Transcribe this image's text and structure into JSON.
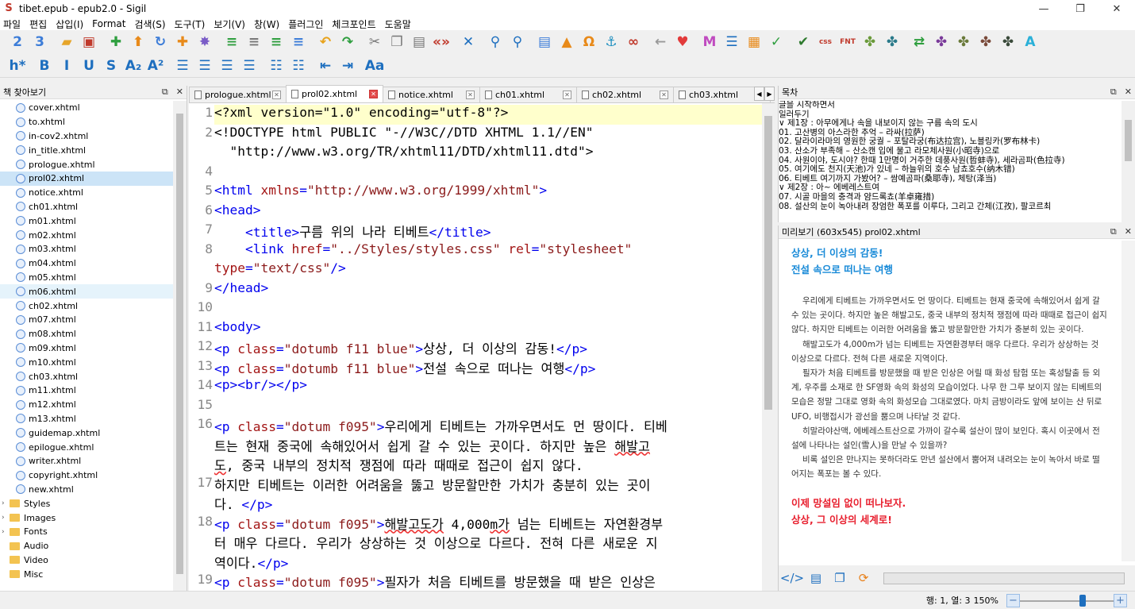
{
  "window": {
    "title": "tibet.epub - epub2.0 - Sigil",
    "app_icon": "S"
  },
  "window_controls": {
    "minimize": "—",
    "maximize": "❐",
    "close": "✕"
  },
  "menu": [
    "파일",
    "편집",
    "삽입(I)",
    "Format",
    "검색(S)",
    "도구(T)",
    "보기(V)",
    "창(W)",
    "플러그인",
    "체크포인트",
    "도움말"
  ],
  "toolbar1": [
    {
      "name": "book-view-2-icon",
      "glyph": "2",
      "color": "#3d7dd8"
    },
    {
      "name": "book-view-3-icon",
      "glyph": "3",
      "color": "#3d7dd8"
    },
    {
      "name": "sep"
    },
    {
      "name": "open-folder-icon",
      "glyph": "▰",
      "color": "#e6a52a"
    },
    {
      "name": "save-icon",
      "glyph": "▣",
      "color": "#c0392b"
    },
    {
      "name": "sep"
    },
    {
      "name": "add-file-icon",
      "glyph": "✚",
      "color": "#2e9e3e"
    },
    {
      "name": "move-up-icon",
      "glyph": "⬆",
      "color": "#e88a1a"
    },
    {
      "name": "refresh-icon",
      "glyph": "↻",
      "color": "#3d7dd8"
    },
    {
      "name": "add-plus-icon",
      "glyph": "✚",
      "color": "#e88a1a"
    },
    {
      "name": "settings-gear-icon",
      "glyph": "✸",
      "color": "#7a5cc7"
    },
    {
      "name": "sep"
    },
    {
      "name": "indent-list-icon",
      "glyph": "≡",
      "color": "#2e9e3e"
    },
    {
      "name": "outdent-list-icon",
      "glyph": "≡",
      "color": "#777"
    },
    {
      "name": "list-add-icon",
      "glyph": "≡",
      "color": "#2e9e3e"
    },
    {
      "name": "list-more-icon",
      "glyph": "≡",
      "color": "#3d7dd8"
    },
    {
      "name": "sep"
    },
    {
      "name": "undo-icon",
      "glyph": "↶",
      "color": "#e8a21a"
    },
    {
      "name": "redo-icon",
      "glyph": "↷",
      "color": "#2e9e3e"
    },
    {
      "name": "sep"
    },
    {
      "name": "cut-icon",
      "glyph": "✂",
      "color": "#777"
    },
    {
      "name": "copy-icon",
      "glyph": "❐",
      "color": "#777"
    },
    {
      "name": "paste-icon",
      "glyph": "▤",
      "color": "#777"
    },
    {
      "name": "code-tag-icon",
      "glyph": "«»",
      "color": "#c0392b"
    },
    {
      "name": "sep"
    },
    {
      "name": "validate-x-icon",
      "glyph": "✕",
      "color": "#1e6fbf"
    },
    {
      "name": "sep"
    },
    {
      "name": "search-icon",
      "glyph": "⚲",
      "color": "#1e6fbf"
    },
    {
      "name": "search-replace-icon",
      "glyph": "⚲",
      "color": "#1e6fbf"
    },
    {
      "name": "sep"
    },
    {
      "name": "insert-file-icon",
      "glyph": "▤",
      "color": "#3d7dd8"
    },
    {
      "name": "insert-image-icon",
      "glyph": "▲",
      "color": "#e88a1a"
    },
    {
      "name": "special-char-omega-icon",
      "glyph": "Ω",
      "color": "#e88a1a"
    },
    {
      "name": "anchor-icon",
      "glyph": "⚓",
      "color": "#1e8fbf"
    },
    {
      "name": "link-icon",
      "glyph": "∞",
      "color": "#c0392b"
    },
    {
      "name": "sep"
    },
    {
      "name": "back-arrow-icon",
      "glyph": "←",
      "color": "#999"
    },
    {
      "name": "heart-icon",
      "glyph": "♥",
      "color": "#e23a3a"
    },
    {
      "name": "sep"
    },
    {
      "name": "metadata-m-icon",
      "glyph": "M",
      "color": "#c04bc0"
    },
    {
      "name": "toc-list-icon",
      "glyph": "☰",
      "color": "#1e6fbf"
    },
    {
      "name": "report-icon",
      "glyph": "▦",
      "color": "#e88a1a"
    },
    {
      "name": "spellcheck-icon",
      "glyph": "✓",
      "color": "#2e9e3e"
    },
    {
      "name": "sep"
    },
    {
      "name": "check-valid-icon",
      "glyph": "✔",
      "color": "#2e7a2e"
    },
    {
      "name": "self-css-icon",
      "glyph": "css",
      "color": "#c0392b"
    },
    {
      "name": "font-css-icon",
      "glyph": "FNT",
      "color": "#c0392b"
    },
    {
      "name": "plugin-green-icon",
      "glyph": "✤",
      "color": "#6a9a3a"
    },
    {
      "name": "plugin-teal-icon",
      "glyph": "✤",
      "color": "#2a7a8a"
    },
    {
      "name": "sep"
    },
    {
      "name": "plugin-swap-icon",
      "glyph": "⇄",
      "color": "#2e9e3e"
    },
    {
      "name": "plugin-purple-icon",
      "glyph": "✤",
      "color": "#7a3a9a"
    },
    {
      "name": "plugin-olive-icon",
      "glyph": "✤",
      "color": "#6a7a3a"
    },
    {
      "name": "plugin-brown-icon",
      "glyph": "✤",
      "color": "#7a4a3a"
    },
    {
      "name": "plugin-dark-icon",
      "glyph": "✤",
      "color": "#3a4a3a"
    },
    {
      "name": "plugin-a-icon",
      "glyph": "A",
      "color": "#2ab0d8"
    }
  ],
  "toolbar2": [
    {
      "name": "heading-icon",
      "glyph": "h*",
      "color": "#1e6fbf"
    },
    {
      "name": "sep"
    },
    {
      "name": "bold-icon",
      "glyph": "B",
      "color": "#1e6fbf"
    },
    {
      "name": "italic-icon",
      "glyph": "I",
      "color": "#1e6fbf"
    },
    {
      "name": "underline-icon",
      "glyph": "U",
      "color": "#1e6fbf"
    },
    {
      "name": "strikethrough-icon",
      "glyph": "S",
      "color": "#1e6fbf"
    },
    {
      "name": "subscript-icon",
      "glyph": "A₂",
      "color": "#1e6fbf"
    },
    {
      "name": "superscript-icon",
      "glyph": "A²",
      "color": "#1e6fbf"
    },
    {
      "name": "sep"
    },
    {
      "name": "align-left-icon",
      "glyph": "☰",
      "color": "#1e6fbf"
    },
    {
      "name": "align-center-icon",
      "glyph": "☰",
      "color": "#1e6fbf"
    },
    {
      "name": "align-right-icon",
      "glyph": "☰",
      "color": "#1e6fbf"
    },
    {
      "name": "align-justify-icon",
      "glyph": "☰",
      "color": "#1e6fbf"
    },
    {
      "name": "sep"
    },
    {
      "name": "bullet-list-icon",
      "glyph": "☷",
      "color": "#1e6fbf"
    },
    {
      "name": "numbered-list-icon",
      "glyph": "☷",
      "color": "#1e6fbf"
    },
    {
      "name": "sep"
    },
    {
      "name": "decrease-indent-icon",
      "glyph": "⇤",
      "color": "#1e6fbf"
    },
    {
      "name": "increase-indent-icon",
      "glyph": "⇥",
      "color": "#1e6fbf"
    },
    {
      "name": "sep"
    },
    {
      "name": "text-case-icon",
      "glyph": "Aa",
      "color": "#1e6fbf"
    }
  ],
  "book_browser": {
    "title": "책 찾아보기",
    "files": [
      "cover.xhtml",
      "to.xhtml",
      "in-cov2.xhtml",
      "in_title.xhtml",
      "prologue.xhtml",
      "prol02.xhtml",
      "notice.xhtml",
      "ch01.xhtml",
      "m01.xhtml",
      "m02.xhtml",
      "m03.xhtml",
      "m04.xhtml",
      "m05.xhtml",
      "m06.xhtml",
      "ch02.xhtml",
      "m07.xhtml",
      "m08.xhtml",
      "m09.xhtml",
      "m10.xhtml",
      "ch03.xhtml",
      "m11.xhtml",
      "m12.xhtml",
      "m13.xhtml",
      "guidemap.xhtml",
      "epilogue.xhtml",
      "writer.xhtml",
      "copyright.xhtml",
      "new.xhtml"
    ],
    "selected": "prol02.xhtml",
    "hovered": "m06.xhtml",
    "folders": [
      "Styles",
      "Images",
      "Fonts",
      "Audio",
      "Video",
      "Misc"
    ]
  },
  "editor": {
    "tabs": [
      "prologue.xhtml",
      "prol02.xhtml",
      "notice.xhtml",
      "ch01.xhtml",
      "ch02.xhtml",
      "ch03.xhtml"
    ],
    "active_tab": "prol02.xhtml",
    "lines": [
      {
        "n": "1",
        "text": [
          [
            "t",
            "<?xml version=\"1.0\" encoding=\"utf-8\"?>"
          ]
        ]
      },
      {
        "n": "2",
        "text": [
          [
            "t",
            "<!DOCTYPE html PUBLIC \"-//W3C//DTD XHTML 1.1//EN\""
          ]
        ]
      },
      {
        "n": "",
        "text": [
          [
            "t",
            "  \"http://www.w3.org/TR/xhtml11/DTD/xhtml11.dtd\">"
          ]
        ]
      },
      {
        "n": "4",
        "text": []
      },
      {
        "n": "5",
        "text": [
          [
            "tg",
            "<html "
          ],
          [
            "at",
            "xmlns"
          ],
          [
            "tg",
            "="
          ],
          [
            "st",
            "\"http://www.w3.org/1999/xhtml\""
          ],
          [
            "tg",
            ">"
          ]
        ]
      },
      {
        "n": "6",
        "text": [
          [
            "tg",
            "<head>"
          ]
        ]
      },
      {
        "n": "7",
        "text": [
          [
            "t",
            "    "
          ],
          [
            "tg",
            "<title>"
          ],
          [
            "t",
            "구름 위의 나라 티베트"
          ],
          [
            "tg",
            "</title>"
          ]
        ]
      },
      {
        "n": "8",
        "text": [
          [
            "t",
            "    "
          ],
          [
            "tg",
            "<link "
          ],
          [
            "at",
            "href"
          ],
          [
            "tg",
            "="
          ],
          [
            "st",
            "\"../Styles/styles.css\""
          ],
          [
            "t",
            " "
          ],
          [
            "at",
            "rel"
          ],
          [
            "tg",
            "="
          ],
          [
            "st",
            "\"stylesheet\""
          ]
        ]
      },
      {
        "n": "",
        "text": [
          [
            "at",
            "type"
          ],
          [
            "tg",
            "="
          ],
          [
            "st",
            "\"text/css\""
          ],
          [
            "tg",
            "/>"
          ]
        ]
      },
      {
        "n": "9",
        "text": [
          [
            "tg",
            "</head>"
          ]
        ]
      },
      {
        "n": "10",
        "text": []
      },
      {
        "n": "11",
        "text": [
          [
            "tg",
            "<body>"
          ]
        ]
      },
      {
        "n": "12",
        "text": [
          [
            "tg",
            "<p "
          ],
          [
            "at",
            "class"
          ],
          [
            "tg",
            "="
          ],
          [
            "st",
            "\"dotumb f11 blue\""
          ],
          [
            "tg",
            ">"
          ],
          [
            "t",
            "상상, 더 이상의 감동!"
          ],
          [
            "tg",
            "</p>"
          ]
        ]
      },
      {
        "n": "13",
        "text": [
          [
            "tg",
            "<p "
          ],
          [
            "at",
            "class"
          ],
          [
            "tg",
            "="
          ],
          [
            "st",
            "\"dotumb f11 blue\""
          ],
          [
            "tg",
            ">"
          ],
          [
            "t",
            "전설 속으로 떠나는 여행"
          ],
          [
            "tg",
            "</p>"
          ]
        ]
      },
      {
        "n": "14",
        "text": [
          [
            "tg",
            "<p><br/></p>"
          ]
        ]
      },
      {
        "n": "15",
        "text": []
      },
      {
        "n": "16",
        "text": [
          [
            "tg",
            "<p "
          ],
          [
            "at",
            "class"
          ],
          [
            "tg",
            "="
          ],
          [
            "st",
            "\"dotum f095\""
          ],
          [
            "tg",
            ">"
          ],
          [
            "t",
            "우리에게 티베트는 가까우면서도 먼 땅이다. 티베"
          ]
        ]
      },
      {
        "n": "",
        "text": [
          [
            "t",
            "트는 현재 중국에 속해있어서 쉽게 갈 수 있는 곳이다. 하지만 높은 "
          ],
          [
            "ul",
            "해발고"
          ]
        ]
      },
      {
        "n": "",
        "text": [
          [
            "ul",
            "도"
          ],
          [
            "t",
            ", 중국 내부의 정치적 쟁점에 따라 때때로 접근이 쉽지 않다."
          ]
        ]
      },
      {
        "n": "17",
        "text": [
          [
            "t",
            "하지만 티베트는 이러한 어려움을 뚫고 방문할만한 가치가 충분히 있는 곳이"
          ]
        ]
      },
      {
        "n": "",
        "text": [
          [
            "t",
            "다. "
          ],
          [
            "tg",
            "</p>"
          ]
        ]
      },
      {
        "n": "18",
        "text": [
          [
            "tg",
            "<p "
          ],
          [
            "at",
            "class"
          ],
          [
            "tg",
            "="
          ],
          [
            "st",
            "\"dotum f095\""
          ],
          [
            "tg",
            ">"
          ],
          [
            "ul",
            "해발고도가"
          ],
          [
            "t",
            " 4,000"
          ],
          [
            "ul",
            "m가"
          ],
          [
            "t",
            " 넘는 티베트는 자연환경부"
          ]
        ]
      },
      {
        "n": "",
        "text": [
          [
            "t",
            "터 매우 다르다. 우리가 상상하는 것 이상으로 다르다. 전혀 다른 새로운 지"
          ]
        ]
      },
      {
        "n": "",
        "text": [
          [
            "t",
            "역이다."
          ],
          [
            "tg",
            "</p>"
          ]
        ]
      },
      {
        "n": "19",
        "text": [
          [
            "tg",
            "<p "
          ],
          [
            "at",
            "class"
          ],
          [
            "tg",
            "="
          ],
          [
            "st",
            "\"dotum f095\""
          ],
          [
            "tg",
            ">"
          ],
          [
            "t",
            "필자가 처음 티베트를 방문했을 때 받은 인상은"
          ]
        ]
      },
      {
        "n": "",
        "text": [
          [
            "t",
            "어릴 때 화성 탐험 또는 "
          ],
          [
            "ul",
            "혹성탈출"
          ],
          [
            "t",
            " 등 외계, 우주를 소재로 한 "
          ],
          [
            "ul",
            "SF영화"
          ],
          [
            "t",
            " 속의"
          ]
        ]
      },
      {
        "n": "",
        "text": [
          [
            "t",
            "화성의 모습이었다. 나무 한 그루 보이지 않는 티베트의 모습은 정말 그대로"
          ]
        ]
      }
    ]
  },
  "toc": {
    "title": "목차",
    "items": [
      "  글을 시작하면서",
      "  일러두기",
      "∨ 제1장 : 아무에게나 속을 내보이지 않는 구름 속의 도시",
      "      01. 고산병의 아스라한 추억 – 라싸(拉萨)",
      "      02. 달라이라마의 영원한 궁궐 – 포탈라궁(布达拉宫), 노블링카(罗布林卡)",
      "      03. 산소가 부족해 – 산소캔 입에 물고 라모체사원(小昭寺)으로",
      "      04. 사원이야, 도시야? 한때 1만명이 거주한 데풍사원(哲蚌寺), 세라곰파(色拉寺)",
      "      05. 여기에도 천지(天池)가 있네 – 하늘위의 호수 남쵸호수(纳木错)",
      "      06. 티베트 여기까지 가봤어? – 쌈예곰파(桑耶寺), 체탕(泽当)",
      "∨ 제2장 : 아~ 에베레스트여",
      "      07. 시골 마을의 충격과 얌드록쵸(羊卓雍措)",
      "      08. 설산의 눈이 녹아내려 장엄한 폭포를 이루다, 그리고 간체(江孜), 팔코르최"
    ]
  },
  "preview": {
    "title": "미리보기 (603x545) prol02.xhtml",
    "heading1": "상상, 더 이상의 감동!",
    "heading2": "전설 속으로 떠나는 여행",
    "p1": "우리에게 티베트는 가까우면서도 먼 땅이다. 티베트는 현재 중국에 속해있어서 쉽게 갈 수 있는 곳이다. 하지만 높은 해발고도, 중국 내부의 정치적 쟁점에 따라 때때로 접근이 쉽지 않다. 하지만 티베트는 이러한 어려움을 뚫고 방문할만한 가치가 충분히 있는 곳이다.",
    "p2": "해발고도가 4,000m가 넘는 티베트는 자연환경부터 매우 다르다. 우리가 상상하는 것 이상으로 다르다. 전혀 다른 새로운 지역이다.",
    "p3": "필자가 처음 티베트를 방문했을 때 받은 인상은 어릴 때 화성 탐험 또는 혹성탈출 등 외계, 우주를 소재로 한 SF영화 속의 화성의 모습이었다. 나무 한 그루 보이지 않는 티베트의 모습은 정말 그대로 영화 속의 화성모습 그대로였다. 마치 금방이라도 앞에 보이는 산 뒤로 UFO, 비행접시가 광선을 뿜으며 나타날 것 같다.",
    "p4": "히말라야산맥, 에베레스트산으로 가까이 갈수록 설산이 많이 보인다. 혹시 이곳에서 전설에 나타나는 설인(雪人)을 만날 수 있을까?",
    "p5": "비록 설인은 만나지는 못하더라도 만년 설산에서 뿜어져 내려오는 눈이 녹아서 바로 떨어지는 폭포는 볼 수 있다.",
    "red1": "이제 망설임 없이 떠나보자.",
    "red2": "상상, 그 이상의 세계로!"
  },
  "status": {
    "position": "행: 1, 열: 3",
    "zoom": "150%",
    "zoom_fraction": 0.68
  },
  "colors": {
    "tag": "#0000ee",
    "attr": "#a31515",
    "string": "#8b1a1a",
    "preview_blue": "#1a8bd8",
    "preview_red": "#e8202f",
    "selected_row": "#cce4f7"
  }
}
